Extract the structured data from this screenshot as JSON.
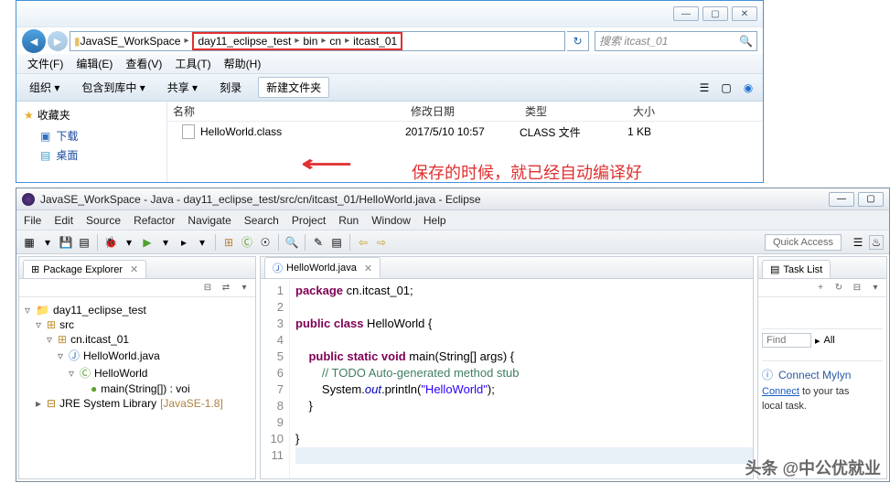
{
  "explorer": {
    "addr": {
      "root": "JavaSE_WorkSpace",
      "p1": "day11_eclipse_test",
      "p2": "bin",
      "p3": "cn",
      "p4": "itcast_01"
    },
    "search_placeholder": "搜索 itcast_01",
    "menu": {
      "file": "文件(F)",
      "edit": "编辑(E)",
      "view": "查看(V)",
      "tools": "工具(T)",
      "help": "帮助(H)"
    },
    "toolbar": {
      "organize": "组织 ▾",
      "include": "包含到库中 ▾",
      "share": "共享 ▾",
      "burn": "刻录",
      "newfolder": "新建文件夹"
    },
    "nav": {
      "favorites": "收藏夹",
      "downloads": "下载",
      "desktop": "桌面"
    },
    "cols": {
      "name": "名称",
      "date": "修改日期",
      "type": "类型",
      "size": "大小"
    },
    "file": {
      "name": "HelloWorld.class",
      "date": "2017/5/10 10:57",
      "type": "CLASS 文件",
      "size": "1 KB"
    }
  },
  "annotation": "保存的时候，就已经自动编译好",
  "eclipse": {
    "title": "JavaSE_WorkSpace - Java - day11_eclipse_test/src/cn/itcast_01/HelloWorld.java - Eclipse",
    "menu": {
      "file": "File",
      "edit": "Edit",
      "source": "Source",
      "refactor": "Refactor",
      "navigate": "Navigate",
      "search": "Search",
      "project": "Project",
      "run": "Run",
      "window": "Window",
      "help": "Help"
    },
    "quick_access": "Quick Access",
    "pkg_explorer": {
      "title": "Package Explorer",
      "project": "day11_eclipse_test",
      "src": "src",
      "pkg": "cn.itcast_01",
      "java": "HelloWorld.java",
      "cls": "HelloWorld",
      "method": "main(String[]) : voi",
      "jre": "JRE System Library",
      "jre_tag": "[JavaSE-1.8]"
    },
    "editor": {
      "tab": "HelloWorld.java",
      "code": {
        "l1_a": "package",
        "l1_b": " cn.itcast_01;",
        "l3_a": "public",
        "l3_b": " class",
        "l3_c": " HelloWorld {",
        "l5_a": "public",
        "l5_b": " static",
        "l5_c": " void",
        "l5_d": " main(String[] args) {",
        "l6": "// TODO Auto-generated method stub",
        "l7_a": "System.",
        "l7_b": "out",
        "l7_c": ".println(",
        "l7_d": "\"HelloWorld\"",
        "l7_e": ");",
        "l8": "}",
        "l10": "}"
      }
    },
    "tasklist": {
      "title": "Task List",
      "find": "Find",
      "all": "All",
      "mylyn_h": "Connect Mylyn",
      "mylyn_link": "Connect",
      "mylyn_t1": " to your tas",
      "mylyn_t2": "local task."
    }
  },
  "watermark": "头条 @中公优就业"
}
